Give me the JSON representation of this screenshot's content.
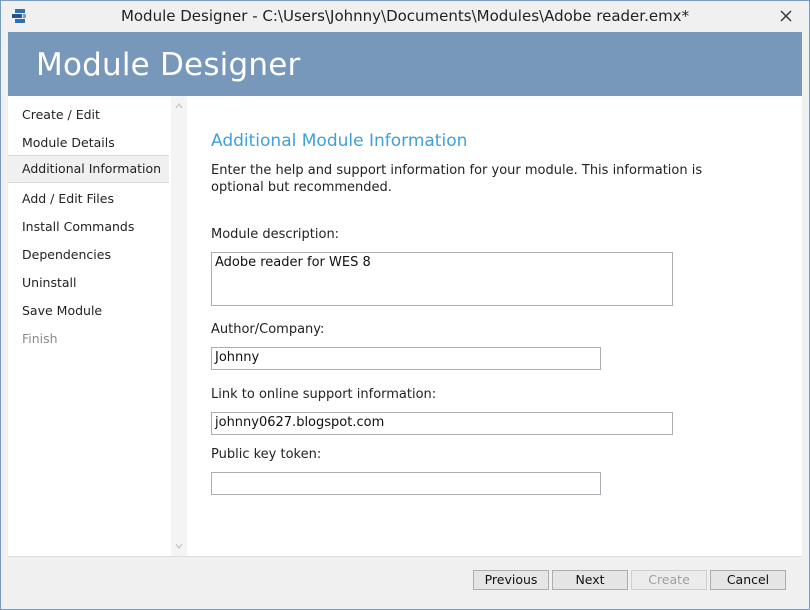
{
  "window": {
    "title": "Module Designer - C:\\Users\\Johnny\\Documents\\Modules\\Adobe reader.emx*",
    "close_icon": "close-icon",
    "app_icon": "module-designer-app-icon"
  },
  "banner": {
    "title": "Module Designer",
    "color": "#7797bb"
  },
  "sidebar": {
    "items": [
      {
        "label": "Create / Edit",
        "state": "normal"
      },
      {
        "label": "Module Details",
        "state": "normal"
      },
      {
        "label": "Additional Information",
        "state": "selected"
      },
      {
        "label": "Add / Edit Files",
        "state": "normal"
      },
      {
        "label": "Install Commands",
        "state": "normal"
      },
      {
        "label": "Dependencies",
        "state": "normal"
      },
      {
        "label": "Uninstall",
        "state": "normal"
      },
      {
        "label": "Save Module",
        "state": "normal"
      },
      {
        "label": "Finish",
        "state": "disabled"
      }
    ]
  },
  "main": {
    "section_title": "Additional Module Information",
    "intro": "Enter the help and support information for your module. This information is optional but recommended.",
    "accent_color": "#3fa0d8",
    "fields": {
      "description": {
        "label": "Module description:",
        "value": "Adobe reader for WES 8"
      },
      "author": {
        "label": "Author/Company:",
        "value": "Johnny"
      },
      "support_link": {
        "label": "Link to online support information:",
        "value": "johnny0627.blogspot.com"
      },
      "public_key": {
        "label": "Public key token:",
        "value": ""
      }
    }
  },
  "footer": {
    "previous": "Previous",
    "next": "Next",
    "create": "Create",
    "cancel": "Cancel"
  }
}
